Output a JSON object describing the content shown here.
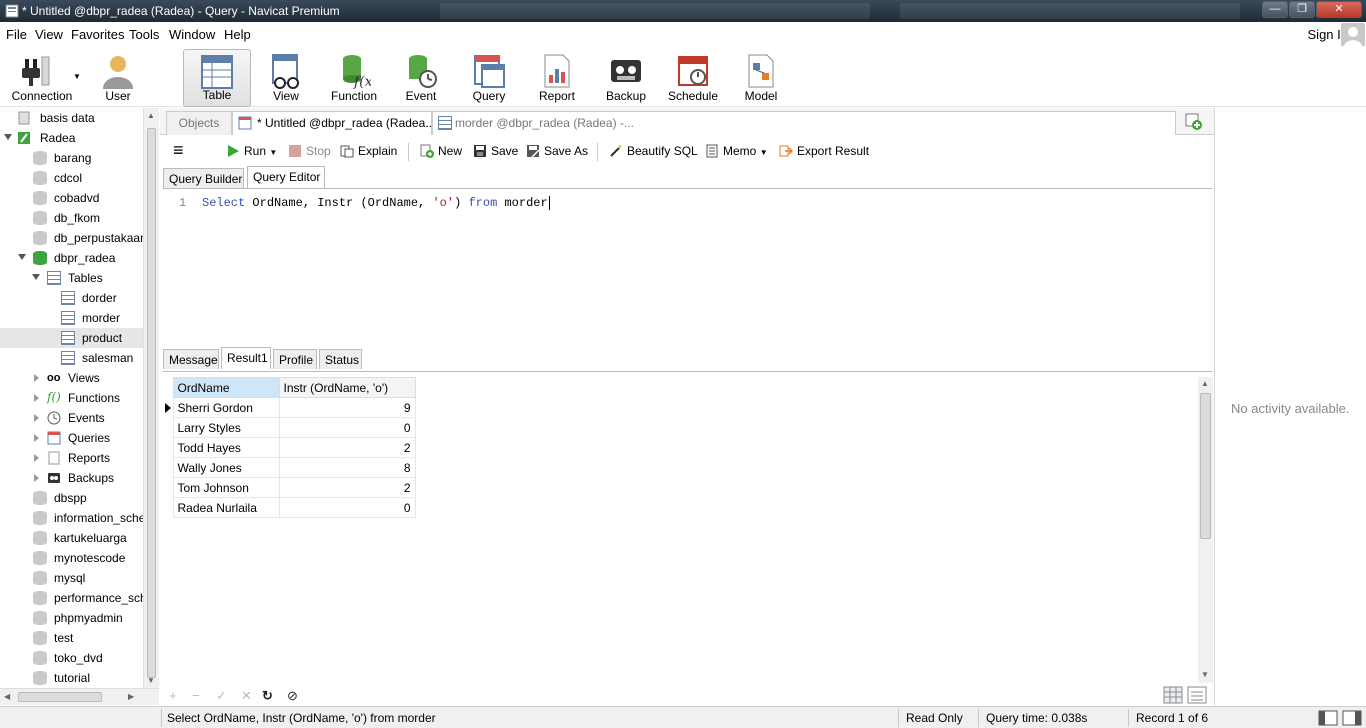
{
  "window": {
    "title": "* Untitled @dbpr_radea (Radea) - Query - Navicat Premium",
    "controls": {
      "minimize": "—",
      "maximize": "❐",
      "close": "✕"
    }
  },
  "menu": {
    "items": [
      "File",
      "View",
      "Favorites",
      "Tools",
      "Window",
      "Help"
    ],
    "sign_in": "Sign In"
  },
  "toolbar": {
    "items": [
      "Connection",
      "User",
      "Table",
      "View",
      "Function",
      "Event",
      "Query",
      "Report",
      "Backup",
      "Schedule",
      "Model"
    ],
    "active": "Table"
  },
  "tree": {
    "items": [
      {
        "label": "basis data"
      },
      {
        "label": "Radea"
      },
      {
        "label": "barang"
      },
      {
        "label": "cdcol"
      },
      {
        "label": "cobadvd"
      },
      {
        "label": "db_fkom"
      },
      {
        "label": "db_perpustakaan"
      },
      {
        "label": "dbpr_radea"
      },
      {
        "label": "Tables"
      },
      {
        "label": "dorder"
      },
      {
        "label": "morder"
      },
      {
        "label": "product"
      },
      {
        "label": "salesman"
      },
      {
        "label": "Views"
      },
      {
        "label": "Functions"
      },
      {
        "label": "Events"
      },
      {
        "label": "Queries"
      },
      {
        "label": "Reports"
      },
      {
        "label": "Backups"
      },
      {
        "label": "dbspp"
      },
      {
        "label": "information_schema"
      },
      {
        "label": "kartukeluarga"
      },
      {
        "label": "mynotescode"
      },
      {
        "label": "mysql"
      },
      {
        "label": "performance_schema"
      },
      {
        "label": "phpmyadmin"
      },
      {
        "label": "test"
      },
      {
        "label": "toko_dvd"
      },
      {
        "label": "tutorial"
      }
    ]
  },
  "doc_tabs": {
    "objects": "Objects",
    "query_tab": "* Untitled @dbpr_radea (Radea...",
    "morder_tab": "morder @dbpr_radea (Radea) -..."
  },
  "query_toolbar": {
    "menu_icon": "≡",
    "run": "Run",
    "stop": "Stop",
    "explain": "Explain",
    "new": "New",
    "save": "Save",
    "save_as": "Save As",
    "beautify": "Beautify SQL",
    "memo": "Memo",
    "export": "Export Result"
  },
  "editor_tabs": {
    "builder": "Query Builder",
    "editor": "Query Editor"
  },
  "editor": {
    "line_number": "1",
    "sql": {
      "kw_select": "Select",
      "cols": " OrdName, Instr (OrdName, ",
      "str": "'o'",
      "close": ") ",
      "kw_from": "from",
      "table": " morder"
    }
  },
  "result_tabs": [
    "Message",
    "Result1",
    "Profile",
    "Status"
  ],
  "grid": {
    "columns": [
      "OrdName",
      "Instr (OrdName, 'o')"
    ],
    "rows": [
      [
        "Sherri Gordon",
        "9"
      ],
      [
        "Larry Styles",
        "0"
      ],
      [
        "Todd Hayes",
        "2"
      ],
      [
        "Wally Jones",
        "8"
      ],
      [
        "Tom Johnson",
        "2"
      ],
      [
        "Radea Nurlaila",
        "0"
      ]
    ]
  },
  "right_panel": {
    "text": "No activity available."
  },
  "status": {
    "sql": "Select OrdName, Instr (OrdName, 'o') from morder",
    "mode": "Read Only",
    "query_time": "Query time: 0.038s",
    "record": "Record 1 of 6"
  },
  "colors": {
    "run_green": "#3aa63a",
    "accent_blue": "#3452b8"
  }
}
